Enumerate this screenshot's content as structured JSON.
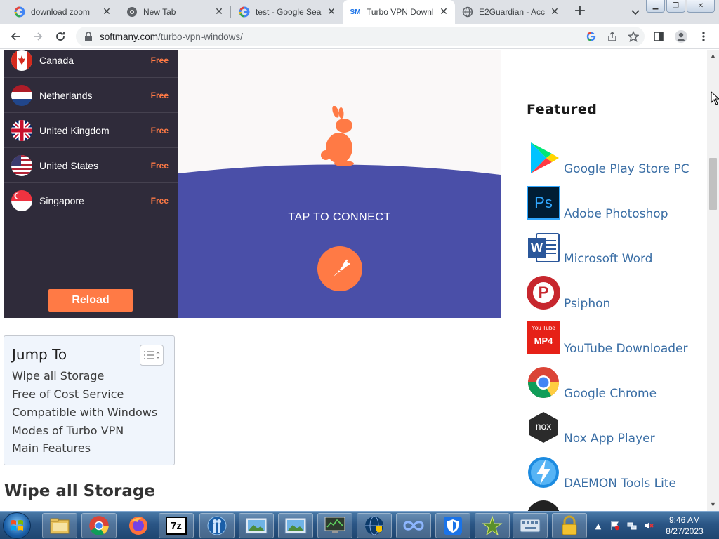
{
  "browser": {
    "tabs": [
      {
        "title": "download zoom ",
        "favicon": "google-icon",
        "active": false
      },
      {
        "title": "New Tab",
        "favicon": "chrome-icon",
        "active": false
      },
      {
        "title": "test - Google Sea",
        "favicon": "google-icon",
        "active": false
      },
      {
        "title": "Turbo VPN Downl",
        "favicon": "softmany-icon",
        "active": true
      },
      {
        "title": "E2Guardian - Acc",
        "favicon": "globe-icon",
        "active": false
      }
    ],
    "url_host": "softmany.com",
    "url_path": "/turbo-vpn-windows/",
    "softmany_favicon_text": "SM"
  },
  "vpn_widget": {
    "countries": [
      {
        "name": "Canada",
        "tag": "Free"
      },
      {
        "name": "Netherlands",
        "tag": "Free"
      },
      {
        "name": "United Kingdom",
        "tag": "Free"
      },
      {
        "name": "United States",
        "tag": "Free"
      },
      {
        "name": "Singapore",
        "tag": "Free"
      }
    ],
    "reload_label": "Reload",
    "tap_label": "TAP TO CONNECT",
    "accent_color": "#ff7a45",
    "panel_color": "#2f2b3a",
    "hill_color": "#4a4fa8"
  },
  "toc": {
    "title": "Jump To",
    "items": [
      "Wipe all Storage",
      "Free of Cost Service",
      "Compatible with Windows",
      "Modes of Turbo VPN",
      "Main Features"
    ]
  },
  "section_heading": "Wipe all Storage",
  "featured": {
    "title": "Featured",
    "items": [
      {
        "label": "Google Play Store PC",
        "icon": "google-play-icon"
      },
      {
        "label": "Adobe Photoshop",
        "icon": "photoshop-icon",
        "icon_text": "Ps"
      },
      {
        "label": "Microsoft Word",
        "icon": "word-icon",
        "icon_text": "W"
      },
      {
        "label": "Psiphon",
        "icon": "psiphon-icon",
        "icon_text": "P"
      },
      {
        "label": "YouTube Downloader",
        "icon": "youtube-mp4-icon",
        "icon_text": "MP4",
        "icon_text_top": "You Tube"
      },
      {
        "label": "Google Chrome",
        "icon": "chrome-icon"
      },
      {
        "label": "Nox App Player",
        "icon": "nox-icon",
        "icon_text": "nox"
      },
      {
        "label": "DAEMON Tools Lite",
        "icon": "daemon-tools-icon"
      }
    ]
  },
  "taskbar": {
    "apps": [
      "file-explorer-icon",
      "chrome-icon",
      "firefox-icon",
      "7zip-icon",
      "people-icon",
      "picture-viewer-icon",
      "picture-viewer-icon",
      "monitor-icon",
      "globe-shield-icon",
      "infinity-icon",
      "shield-icon",
      "star-tool-icon",
      "keyboard-icon",
      "lock-icon"
    ],
    "sevenzip_text": "7z",
    "time": "9:46 AM",
    "date": "8/27/2023"
  }
}
